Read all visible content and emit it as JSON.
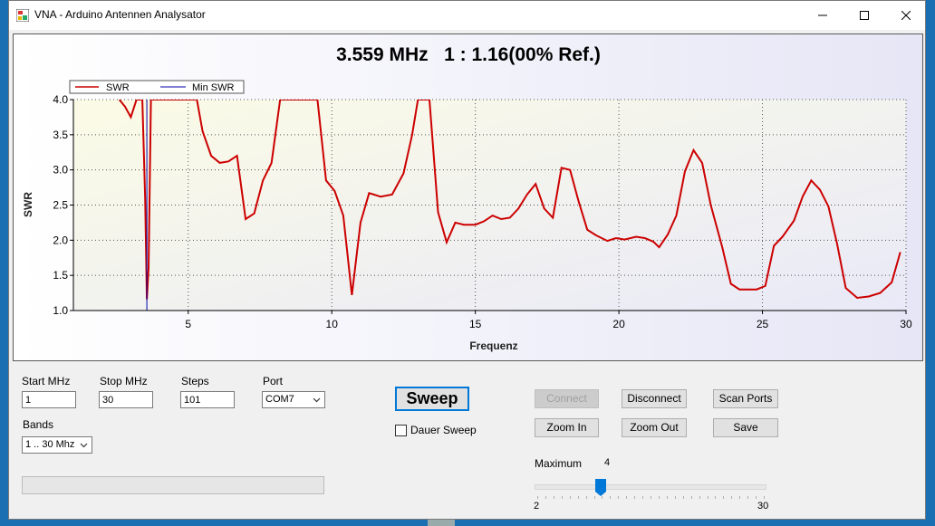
{
  "window": {
    "title": "VNA - Arduino Antennen Analysator",
    "controls": [
      "minimize",
      "maximize",
      "close"
    ]
  },
  "header": {
    "readout": "3.559 MHz   1 : 1.16(00% Ref.)"
  },
  "legend": {
    "entries": [
      {
        "label": "SWR",
        "color": "#cc0000"
      },
      {
        "label": "Min SWR",
        "color": "#0000aa"
      }
    ]
  },
  "chart_data": {
    "type": "line",
    "xlabel": "Frequenz",
    "ylabel": "SWR",
    "xlim": [
      1,
      30
    ],
    "ylim": [
      1.0,
      4.0
    ],
    "x_ticks": [
      "5",
      "10",
      "15",
      "20",
      "25",
      "30"
    ],
    "y_ticks": [
      "1.0",
      "1.5",
      "2.0",
      "2.5",
      "3.0",
      "3.5",
      "4.0"
    ],
    "grid": true,
    "legend_position": "top-left",
    "background": [
      "#fbfbe6",
      "#e9e9f8"
    ],
    "series": [
      {
        "name": "SWR",
        "color": "#cc0000",
        "points": [
          [
            2.6,
            4.0
          ],
          [
            2.8,
            3.9
          ],
          [
            3.0,
            3.75
          ],
          [
            3.2,
            4.0
          ],
          [
            3.4,
            4.0
          ],
          [
            3.5,
            2.6
          ],
          [
            3.559,
            1.16
          ],
          [
            3.62,
            1.6
          ],
          [
            3.7,
            4.0
          ],
          [
            5.3,
            4.0
          ],
          [
            5.5,
            3.55
          ],
          [
            5.8,
            3.2
          ],
          [
            6.1,
            3.1
          ],
          [
            6.4,
            3.12
          ],
          [
            6.7,
            3.2
          ],
          [
            7.0,
            2.3
          ],
          [
            7.3,
            2.38
          ],
          [
            7.6,
            2.85
          ],
          [
            7.9,
            3.1
          ],
          [
            8.2,
            4.0
          ],
          [
            9.5,
            4.0
          ],
          [
            9.8,
            2.85
          ],
          [
            10.1,
            2.7
          ],
          [
            10.4,
            2.35
          ],
          [
            10.7,
            1.22
          ],
          [
            11.0,
            2.25
          ],
          [
            11.3,
            2.67
          ],
          [
            11.7,
            2.62
          ],
          [
            12.1,
            2.65
          ],
          [
            12.5,
            2.95
          ],
          [
            12.8,
            3.5
          ],
          [
            13.0,
            4.0
          ],
          [
            13.4,
            4.0
          ],
          [
            13.7,
            2.4
          ],
          [
            14.0,
            1.97
          ],
          [
            14.3,
            2.25
          ],
          [
            14.6,
            2.22
          ],
          [
            15.0,
            2.22
          ],
          [
            15.3,
            2.27
          ],
          [
            15.6,
            2.35
          ],
          [
            15.9,
            2.3
          ],
          [
            16.2,
            2.32
          ],
          [
            16.5,
            2.45
          ],
          [
            16.8,
            2.65
          ],
          [
            17.1,
            2.8
          ],
          [
            17.4,
            2.45
          ],
          [
            17.7,
            2.32
          ],
          [
            18.0,
            3.03
          ],
          [
            18.3,
            3.0
          ],
          [
            18.6,
            2.55
          ],
          [
            18.9,
            2.15
          ],
          [
            19.2,
            2.07
          ],
          [
            19.6,
            1.99
          ],
          [
            19.9,
            2.03
          ],
          [
            20.2,
            2.01
          ],
          [
            20.6,
            2.05
          ],
          [
            20.9,
            2.03
          ],
          [
            21.2,
            1.98
          ],
          [
            21.4,
            1.9
          ],
          [
            21.7,
            2.08
          ],
          [
            22.0,
            2.35
          ],
          [
            22.3,
            2.98
          ],
          [
            22.6,
            3.28
          ],
          [
            22.9,
            3.1
          ],
          [
            23.2,
            2.5
          ],
          [
            23.6,
            1.9
          ],
          [
            23.9,
            1.38
          ],
          [
            24.2,
            1.3
          ],
          [
            24.5,
            1.3
          ],
          [
            24.8,
            1.3
          ],
          [
            25.1,
            1.35
          ],
          [
            25.4,
            1.92
          ],
          [
            25.7,
            2.05
          ],
          [
            26.1,
            2.28
          ],
          [
            26.4,
            2.62
          ],
          [
            26.7,
            2.85
          ],
          [
            27.0,
            2.72
          ],
          [
            27.3,
            2.48
          ],
          [
            27.6,
            1.95
          ],
          [
            27.9,
            1.32
          ],
          [
            28.3,
            1.18
          ],
          [
            28.7,
            1.2
          ],
          [
            29.1,
            1.25
          ],
          [
            29.5,
            1.4
          ],
          [
            29.8,
            1.83
          ]
        ]
      },
      {
        "name": "Min SWR",
        "color": "#0000aa",
        "marker_x": 3.559
      }
    ]
  },
  "controls": {
    "start_label": "Start MHz",
    "start_value": "1",
    "stop_label": "Stop MHz",
    "stop_value": "30",
    "steps_label": "Steps",
    "steps_value": "101",
    "port_label": "Port",
    "port_value": "COM7",
    "bands_label": "Bands",
    "bands_value": "1 .. 30 Mhz",
    "sweep_label": "Sweep",
    "dauer_label": "Dauer Sweep",
    "dauer_checked": false,
    "connect_label": "Connect",
    "disconnect_label": "Disconnect",
    "scan_label": "Scan Ports",
    "zoomin_label": "Zoom In",
    "zoomout_label": "Zoom Out",
    "save_label": "Save",
    "maximum_label": "Maximum",
    "maximum_value": "4",
    "slider_min_label": "2",
    "slider_max_label": "30",
    "progress_fraction": 0.0
  }
}
